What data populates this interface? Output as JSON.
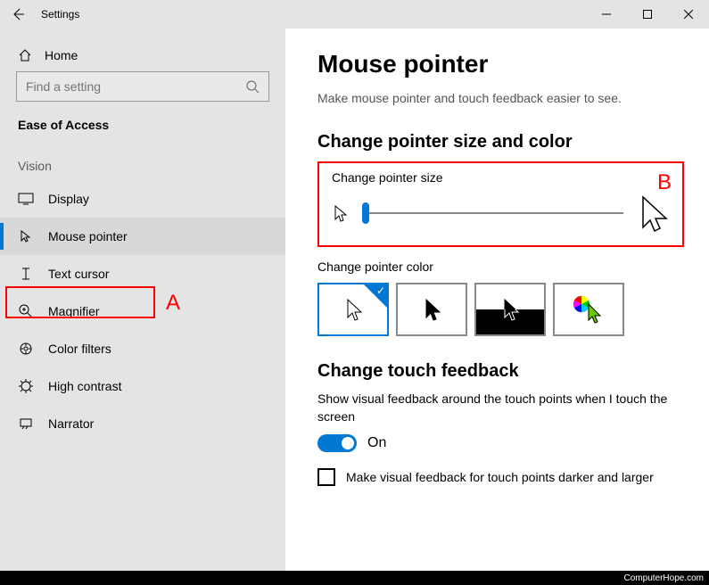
{
  "window": {
    "title": "Settings"
  },
  "sidebar": {
    "home": "Home",
    "search_placeholder": "Find a setting",
    "section": "Ease of Access",
    "group": "Vision",
    "items": [
      {
        "label": "Display"
      },
      {
        "label": "Mouse pointer"
      },
      {
        "label": "Text cursor"
      },
      {
        "label": "Magnifier"
      },
      {
        "label": "Color filters"
      },
      {
        "label": "High contrast"
      },
      {
        "label": "Narrator"
      }
    ]
  },
  "main": {
    "title": "Mouse pointer",
    "subtitle": "Make mouse pointer and touch feedback easier to see.",
    "section_size_color": "Change pointer size and color",
    "pointer_size_label": "Change pointer size",
    "pointer_color_label": "Change pointer color",
    "section_touch": "Change touch feedback",
    "touch_desc": "Show visual feedback around the touch points when I touch the screen",
    "toggle_state": "On",
    "checkbox_label": "Make visual feedback for touch points darker and larger"
  },
  "annotations": {
    "A": "A",
    "B": "B"
  },
  "footer": "ComputerHope.com"
}
